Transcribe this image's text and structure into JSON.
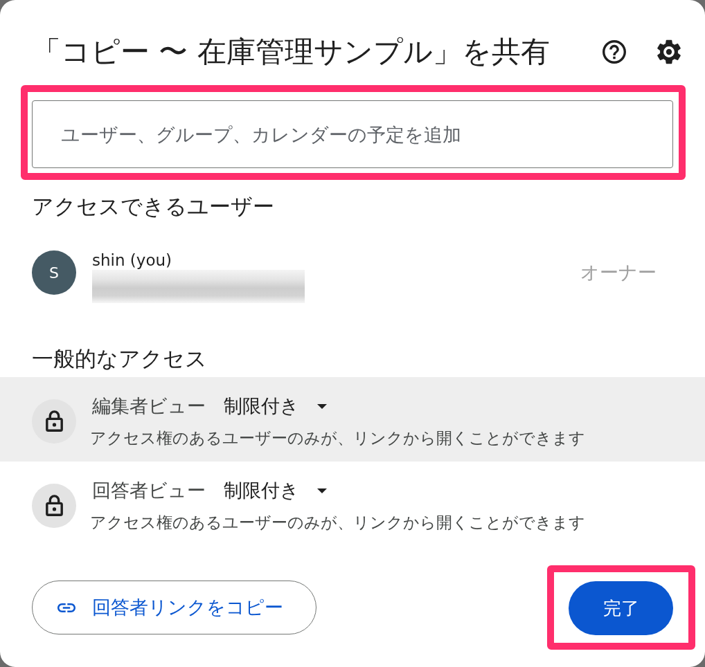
{
  "dialog": {
    "title": "「コピー 〜 在庫管理サンプル」を共有"
  },
  "add_people": {
    "placeholder": "ユーザー、グループ、カレンダーの予定を追加",
    "highlighted": true
  },
  "people_access": {
    "heading": "アクセスできるユーザー",
    "people": [
      {
        "initial": "S",
        "name": "shin (you)",
        "role": "オーナー"
      }
    ]
  },
  "general_access": {
    "heading": "一般的なアクセス",
    "rows": [
      {
        "audience": "編集者ビュー",
        "setting": "制限付き",
        "description": "アクセス権のあるユーザーのみが、リンクから開くことができます",
        "selected": true
      },
      {
        "audience": "回答者ビュー",
        "setting": "制限付き",
        "description": "アクセス権のあるユーザーのみが、リンクから開くことができます",
        "selected": false
      }
    ]
  },
  "footer": {
    "copy_link": {
      "label": "回答者リンクをコピー"
    },
    "done": {
      "label": "完了",
      "highlighted": true
    }
  }
}
